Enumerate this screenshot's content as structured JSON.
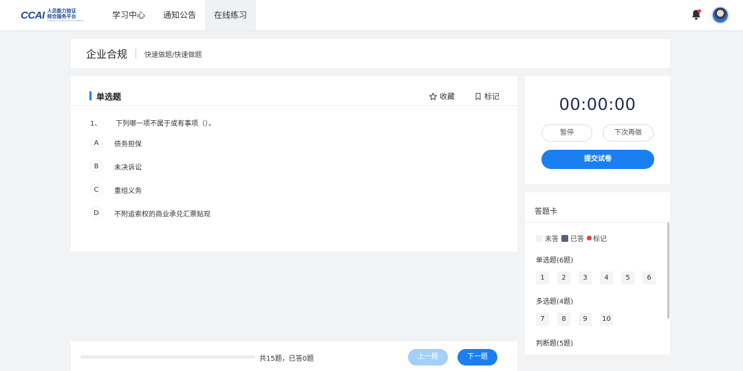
{
  "logo": {
    "mark": "CCAI",
    "name_line1": "人员能力验证",
    "name_line2": "综合服务平台",
    "tagline": "Proficiency Testing Service Platform"
  },
  "nav": [
    {
      "label": "学习中心",
      "active": false
    },
    {
      "label": "通知公告",
      "active": false
    },
    {
      "label": "在线练习",
      "active": true
    }
  ],
  "header": {
    "title": "企业合规",
    "subtitle": "快速做题/快速做题"
  },
  "question": {
    "type": "单选题",
    "favorite_label": "收藏",
    "mark_label": "标记",
    "number": "1、",
    "stem": "下列哪一项不属于或有事项（）。",
    "options": [
      {
        "key": "A",
        "text": "债务担保"
      },
      {
        "key": "B",
        "text": "未决诉讼"
      },
      {
        "key": "C",
        "text": "重组义务"
      },
      {
        "key": "D",
        "text": "不附追索权的商业承兑汇票贴现"
      }
    ]
  },
  "footer": {
    "progress": 0,
    "progress_text": "共15题，已答0题",
    "prev_label": "上一题",
    "next_label": "下一题"
  },
  "timer": {
    "value": "00:00:00",
    "pause_label": "暂停",
    "later_label": "下次再做",
    "submit_label": "提交试卷"
  },
  "answer_card": {
    "title": "答题卡",
    "legend": {
      "unanswered": "未答",
      "answered": "已答",
      "marked": "标记"
    },
    "sections": [
      {
        "label": "单选题(6题)",
        "items": [
          "1",
          "2",
          "3",
          "4",
          "5",
          "6"
        ]
      },
      {
        "label": "多选题(4题)",
        "items": [
          "7",
          "8",
          "9",
          "10"
        ]
      },
      {
        "label": "判断题(5题)",
        "items": []
      }
    ]
  },
  "colors": {
    "accent": "#1a7ff0",
    "answered": "#55607f",
    "marked": "#ef3c3c"
  }
}
